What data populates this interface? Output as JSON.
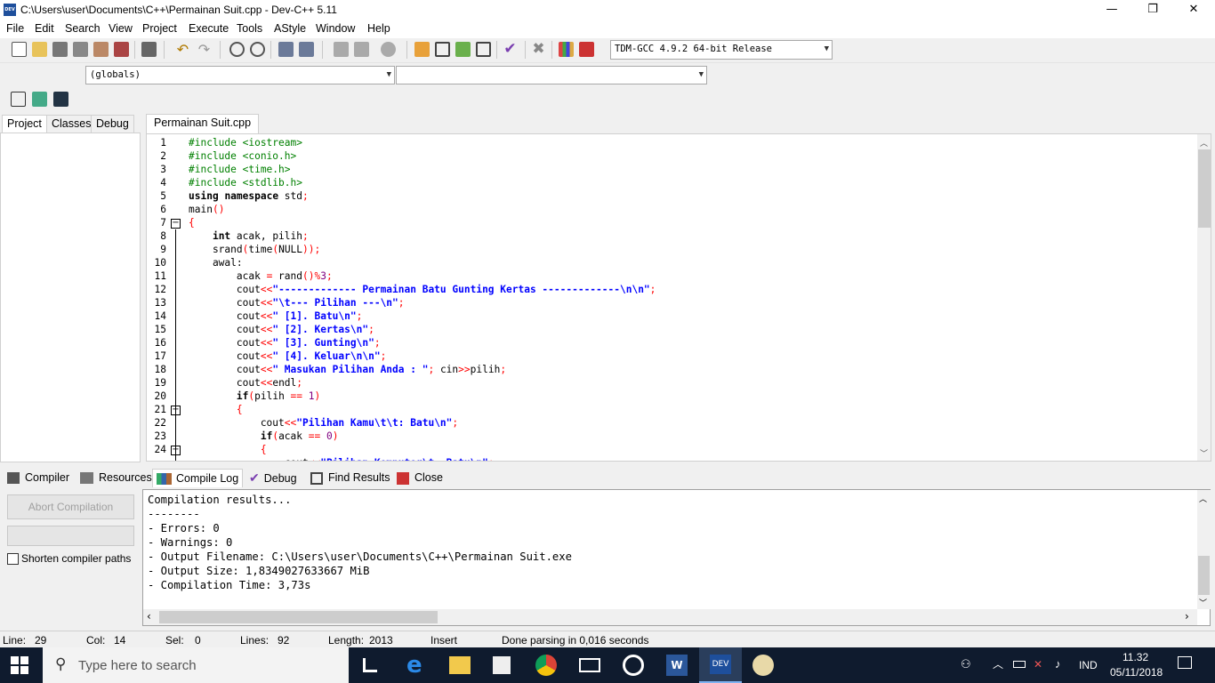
{
  "window": {
    "title": "C:\\Users\\user\\Documents\\C++\\Permainan Suit.cpp - Dev-C++ 5.11",
    "app_icon_label": "DEV",
    "controls": [
      "—",
      "❐",
      "✕"
    ]
  },
  "menu": [
    "File",
    "Edit",
    "Search",
    "View",
    "Project",
    "Execute",
    "Tools",
    "AStyle",
    "Window",
    "Help"
  ],
  "toolbar": {
    "compiler_select": "TDM-GCC 4.9.2 64-bit Release",
    "scope_select": "(globals)",
    "member_select": ""
  },
  "left_tabs": [
    "Project",
    "Classes",
    "Debug"
  ],
  "editor_tab": "Permainan Suit.cpp",
  "code": {
    "line_numbers": [
      "1",
      "2",
      "3",
      "4",
      "5",
      "6",
      "7",
      "8",
      "9",
      "10",
      "11",
      "12",
      "13",
      "14",
      "15",
      "16",
      "17",
      "18",
      "19",
      "20",
      "21",
      "22",
      "23",
      "24"
    ],
    "fold_lines": [
      7,
      21,
      24
    ],
    "lines": [
      "#include <iostream>",
      "#include <conio.h>",
      "#include <time.h>",
      "#include <stdlib.h>",
      "using namespace std;",
      "main()",
      "{",
      "    int acak, pilih;",
      "    srand(time(NULL));",
      "    awal:",
      "        acak = rand()%3;",
      "        cout<<\"------------- Permainan Batu Gunting Kertas -------------\\n\\n\";",
      "        cout<<\"\\t--- Pilihan ---\\n\";",
      "        cout<<\" [1]. Batu\\n\";",
      "        cout<<\" [2]. Kertas\\n\";",
      "        cout<<\" [3]. Gunting\\n\";",
      "        cout<<\" [4]. Keluar\\n\\n\";",
      "        cout<<\" Masukan Pilihan Anda : \"; cin>>pilih;",
      "        cout<<endl;",
      "        if(pilih == 1)",
      "        {",
      "            cout<<\"Pilihan Kamu\\t\\t: Batu\\n\";",
      "            if(acak == 0)",
      "            {"
    ],
    "partial_line": "                cout<<\"Pilihan Komputer\\t: Batu\\n\";"
  },
  "bottom_tabs": [
    "Compiler",
    "Resources",
    "Compile Log",
    "Debug",
    "Find Results",
    "Close"
  ],
  "compile_panel": {
    "abort_button": "Abort Compilation",
    "shorten_paths_label": "Shorten compiler paths",
    "log": [
      "Compilation results...",
      "--------",
      "- Errors: 0",
      "- Warnings: 0",
      "- Output Filename: C:\\Users\\user\\Documents\\C++\\Permainan Suit.exe",
      "- Output Size: 1,8349027633667 MiB",
      "- Compilation Time: 3,73s"
    ]
  },
  "status": {
    "line_label": "Line:",
    "line_value": "29",
    "col_label": "Col:",
    "col_value": "14",
    "sel_label": "Sel:",
    "sel_value": "0",
    "lines_label": "Lines:",
    "lines_value": "92",
    "length_label": "Length:",
    "length_value": "2013",
    "mode": "Insert",
    "message": "Done parsing in 0,016 seconds"
  },
  "taskbar": {
    "search_placeholder": "Type here to search",
    "language": "IND",
    "time": "11.32",
    "date": "05/11/2018"
  },
  "colors": {
    "preprocessor": "#008000",
    "keyword": "#000000",
    "string": "#0000ff",
    "symbol": "#ff0000",
    "number": "#800080"
  }
}
